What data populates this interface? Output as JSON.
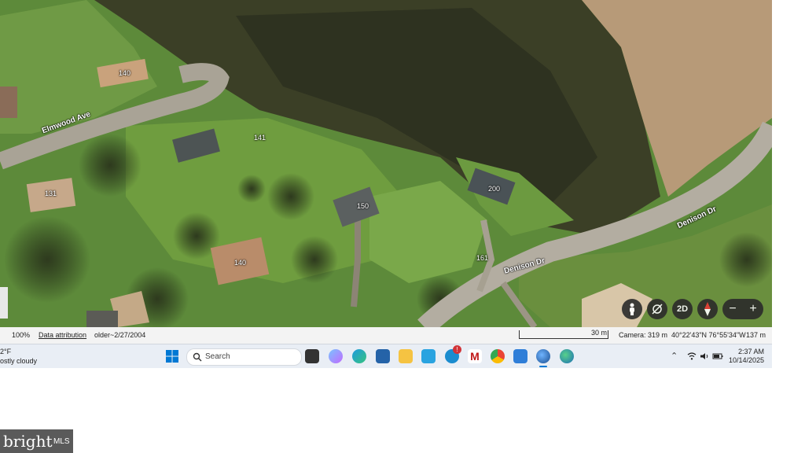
{
  "map": {
    "house_numbers": [
      "140",
      "141",
      "131",
      "150",
      "200",
      "140",
      "161"
    ],
    "streets": [
      "Elmwood Ave",
      "Denison Dr",
      "Denison Dr"
    ],
    "controls": {
      "view_mode": "2D",
      "zoom_out": "−",
      "zoom_in": "+"
    }
  },
  "status": {
    "zoom": "100%",
    "attribution": "Data attribution",
    "imagery_date": "older~2/27/2004",
    "scale": "30 m",
    "camera": "Camera: 319 m",
    "coords": "40°22'43\"N 76°55'34\"W",
    "elevation": "137 m"
  },
  "taskbar": {
    "weather_temp": "2°F",
    "weather_desc": "ostly cloudy",
    "search_placeholder": "Search",
    "notification_badge": "!",
    "time": "2:37 AM",
    "date": "10/14/2025"
  },
  "watermark": {
    "text": "bright",
    "suffix": "MLS"
  }
}
